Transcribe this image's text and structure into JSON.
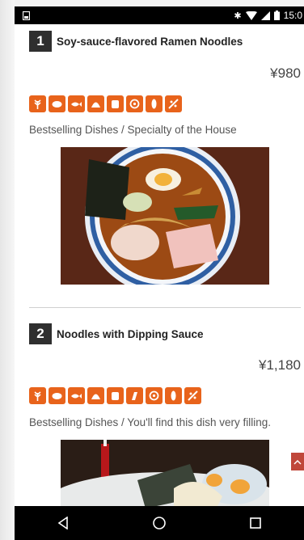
{
  "status_bar": {
    "time": "15:0",
    "icons": [
      "notification-icon",
      "bluetooth-icon",
      "wifi-icon",
      "signal-icon",
      "battery-icon"
    ]
  },
  "menu": [
    {
      "number": "1",
      "title": "Soy-sauce-flavored Ramen Noodles",
      "price": "¥980",
      "allergen_icons": [
        "wheat-icon",
        "pork-icon",
        "fish-icon",
        "shellfish-icon",
        "egg-icon",
        "soy-icon",
        "grain-icon",
        "sesame-icon"
      ],
      "description": "Bestselling Dishes / Specialty of the House",
      "photo": "ramen-bowl-photo"
    },
    {
      "number": "2",
      "title": "Noodles with Dipping Sauce",
      "price": "¥1,180",
      "allergen_icons": [
        "wheat-icon",
        "pork-icon",
        "fish-icon",
        "shellfish-icon",
        "egg-icon",
        "chicken-icon",
        "soy-icon",
        "grain-icon",
        "sesame-icon"
      ],
      "description": "Bestselling Dishes / You'll find this dish very filling.",
      "photo": "tsukemen-photo"
    }
  ],
  "colors": {
    "accent": "#e8631b",
    "number_badge": "#2f2f2f",
    "scroll_tab": "#c0473a"
  },
  "navigation": [
    "back-icon",
    "home-icon",
    "recents-icon"
  ]
}
